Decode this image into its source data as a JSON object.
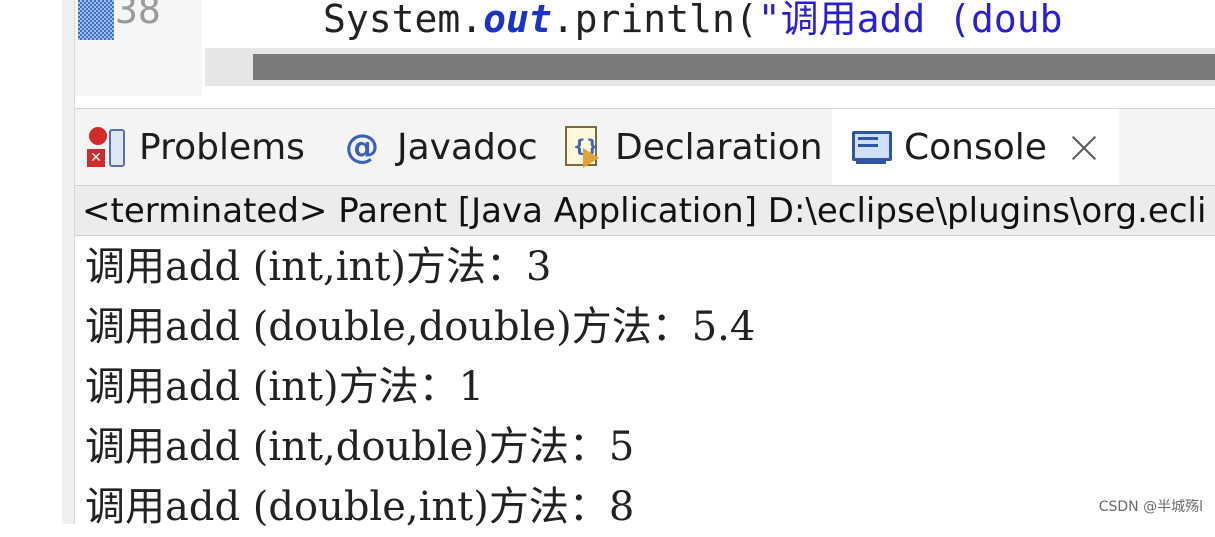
{
  "editor": {
    "line_number": "38",
    "code_prefix": "System.",
    "code_keyword": "out",
    "code_method": ".println(",
    "code_string": "\"调用add (doub"
  },
  "tabs": [
    {
      "label": "Problems",
      "icon": "problems-icon",
      "active": false
    },
    {
      "label": "Javadoc",
      "icon": "at-icon",
      "active": false
    },
    {
      "label": "Declaration",
      "icon": "declaration-icon",
      "active": false
    },
    {
      "label": "Console",
      "icon": "console-icon",
      "active": true
    }
  ],
  "at_symbol": "@",
  "console": {
    "status": "<terminated> Parent [Java Application] D:\\eclipse\\plugins\\org.ecli",
    "lines": [
      "调用add (int,int)方法：3",
      "调用add (double,double)方法：5.4",
      "调用add (int)方法：1",
      "调用add (int,double)方法：5",
      "调用add (double,int)方法：8"
    ]
  },
  "watermark": "CSDN @半城殇l",
  "colors": {
    "keyword": "#1a33c8",
    "string": "#2a1fd2",
    "tab_bg": "#f4f4f4",
    "status_bg": "#ececec"
  }
}
